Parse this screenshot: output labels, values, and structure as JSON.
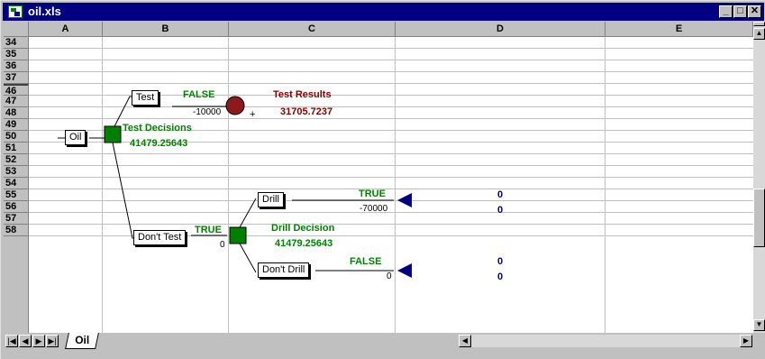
{
  "window": {
    "title": "oil.xls"
  },
  "columns": [
    "A",
    "B",
    "C",
    "D",
    "E"
  ],
  "rows": [
    "34",
    "35",
    "36",
    "37",
    "46",
    "47",
    "48",
    "49",
    "50",
    "51",
    "52",
    "53",
    "54",
    "55",
    "56",
    "57",
    "58"
  ],
  "tree": {
    "oil_label": "Oil",
    "test": {
      "label": "Test",
      "flag": "FALSE",
      "value": "-10000",
      "plus": "+"
    },
    "test_results": {
      "title": "Test Results",
      "value": "31705.7237"
    },
    "test_decisions": {
      "title": "Test Decisions",
      "value": "41479.25643"
    },
    "drill": {
      "label": "Drill",
      "flag": "TRUE",
      "value": "-70000",
      "result_top": "0",
      "result_bottom": "0"
    },
    "dont_test": {
      "label": "Don't Test",
      "flag": "TRUE",
      "value": "0"
    },
    "drill_decision": {
      "title": "Drill Decision",
      "value": "41479.25643"
    },
    "dont_drill": {
      "label": "Don't Drill",
      "flag": "FALSE",
      "value": "0",
      "result_top": "0",
      "result_bottom": "0"
    }
  },
  "sheet_tab": "Oil",
  "colors": {
    "titlebar": "#000080",
    "decision_green": "#008000",
    "chance_red": "#8b1a1a",
    "terminal_blue": "#000080",
    "results_red": "#800000"
  }
}
